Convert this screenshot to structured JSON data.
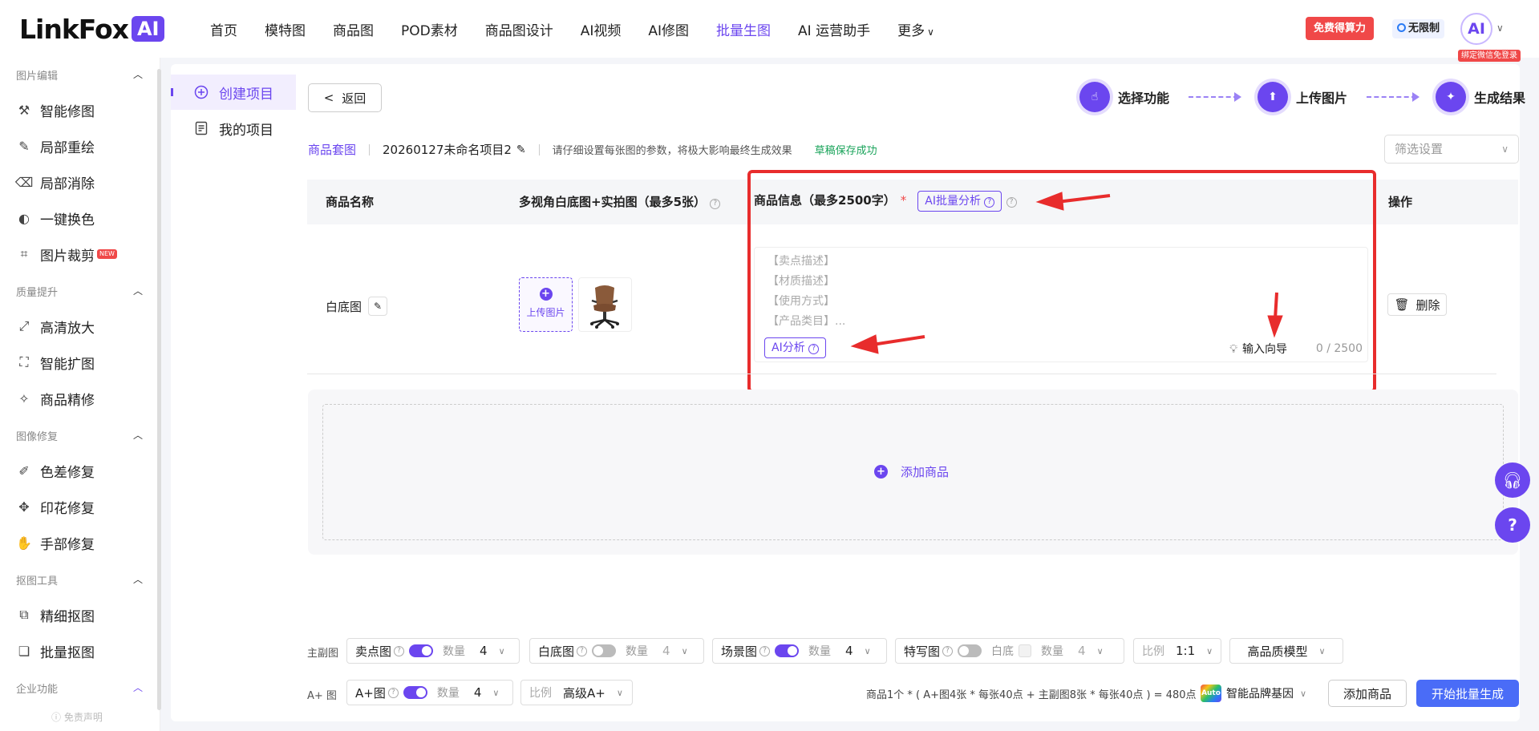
{
  "header": {
    "logo_text": "LinkFox",
    "logo_badge": "AI",
    "nav": [
      "首页",
      "模特图",
      "商品图",
      "POD素材",
      "商品图设计",
      "AI视频",
      "AI修图",
      "批量生图",
      "AI 运营助手",
      "更多"
    ],
    "active_nav": "批量生图",
    "free_button": "免费得算力",
    "unlimited": "无限制",
    "avatar_text": "AI",
    "bind_tag": "绑定微信免登录"
  },
  "sidebar": {
    "groups": [
      {
        "title": "图片编辑",
        "items": [
          "智能修图",
          "局部重绘",
          "局部消除",
          "一键换色",
          "图片裁剪"
        ]
      },
      {
        "title": "质量提升",
        "items": [
          "高清放大",
          "智能扩图",
          "商品精修"
        ]
      },
      {
        "title": "图像修复",
        "items": [
          "色差修复",
          "印花修复",
          "手部修复"
        ]
      },
      {
        "title": "抠图工具",
        "items": [
          "精细抠图",
          "批量抠图"
        ]
      },
      {
        "title": "企业功能",
        "items": []
      }
    ],
    "new_badge": "NEW",
    "footer": "免责声明"
  },
  "subnav": {
    "create": "创建项目",
    "mine": "我的项目"
  },
  "content": {
    "back": "返回",
    "steps": [
      "选择功能",
      "上传图片",
      "生成结果"
    ],
    "set_type": "商品套图",
    "project_name": "20260127未命名项目2",
    "hint": "请仔细设置每张图的参数，将极大影响最终生成效果",
    "saved": "草稿保存成功",
    "filter_placeholder": "筛选设置",
    "table": {
      "col_name": "商品名称",
      "col_images": "多视角白底图+实拍图（最多5张）",
      "col_info": "商品信息（最多2500字）",
      "col_info_star": "*",
      "ai_batch": "AI批量分析",
      "col_op": "操作"
    },
    "row": {
      "name": "白底图",
      "upload": "上传图片",
      "placeholders": [
        "【卖点描述】",
        "【材质描述】",
        "【使用方式】",
        "【产品类目】..."
      ],
      "ai_analyze": "AI分析",
      "guide": "输入向导",
      "count": "0 / 2500",
      "delete": "删除"
    },
    "add_product": "添加商品"
  },
  "bottom": {
    "main_label": "主副图",
    "aplus_label": "A+ 图",
    "selling": {
      "label": "卖点图",
      "qty_label": "数量",
      "qty": "4"
    },
    "white": {
      "label": "白底图",
      "qty_label": "数量",
      "qty": "4"
    },
    "scene": {
      "label": "场景图",
      "qty_label": "数量",
      "qty": "4"
    },
    "closeup": {
      "label": "特写图",
      "white_label": "白底",
      "qty_label": "数量",
      "qty": "4"
    },
    "ratio": {
      "label": "比例",
      "value": "1:1"
    },
    "quality_model": "高品质模型",
    "aplus": {
      "label": "A+图",
      "qty_label": "数量",
      "qty": "4"
    },
    "aplus_ratio": {
      "label": "比例",
      "value": "高级A+"
    },
    "formula": "商品1个 * ( A+图4张 * 每张40点 + 主副图8张 * 每张40点 ) = 480点",
    "brand_gene": "智能品牌基因",
    "auto_badge": "Auto",
    "add_product": "添加商品",
    "start": "开始批量生成"
  },
  "colors": {
    "accent": "#6b46ef",
    "alert": "#f04848",
    "success": "#19a35a",
    "primary_button": "#4a6cf7"
  }
}
